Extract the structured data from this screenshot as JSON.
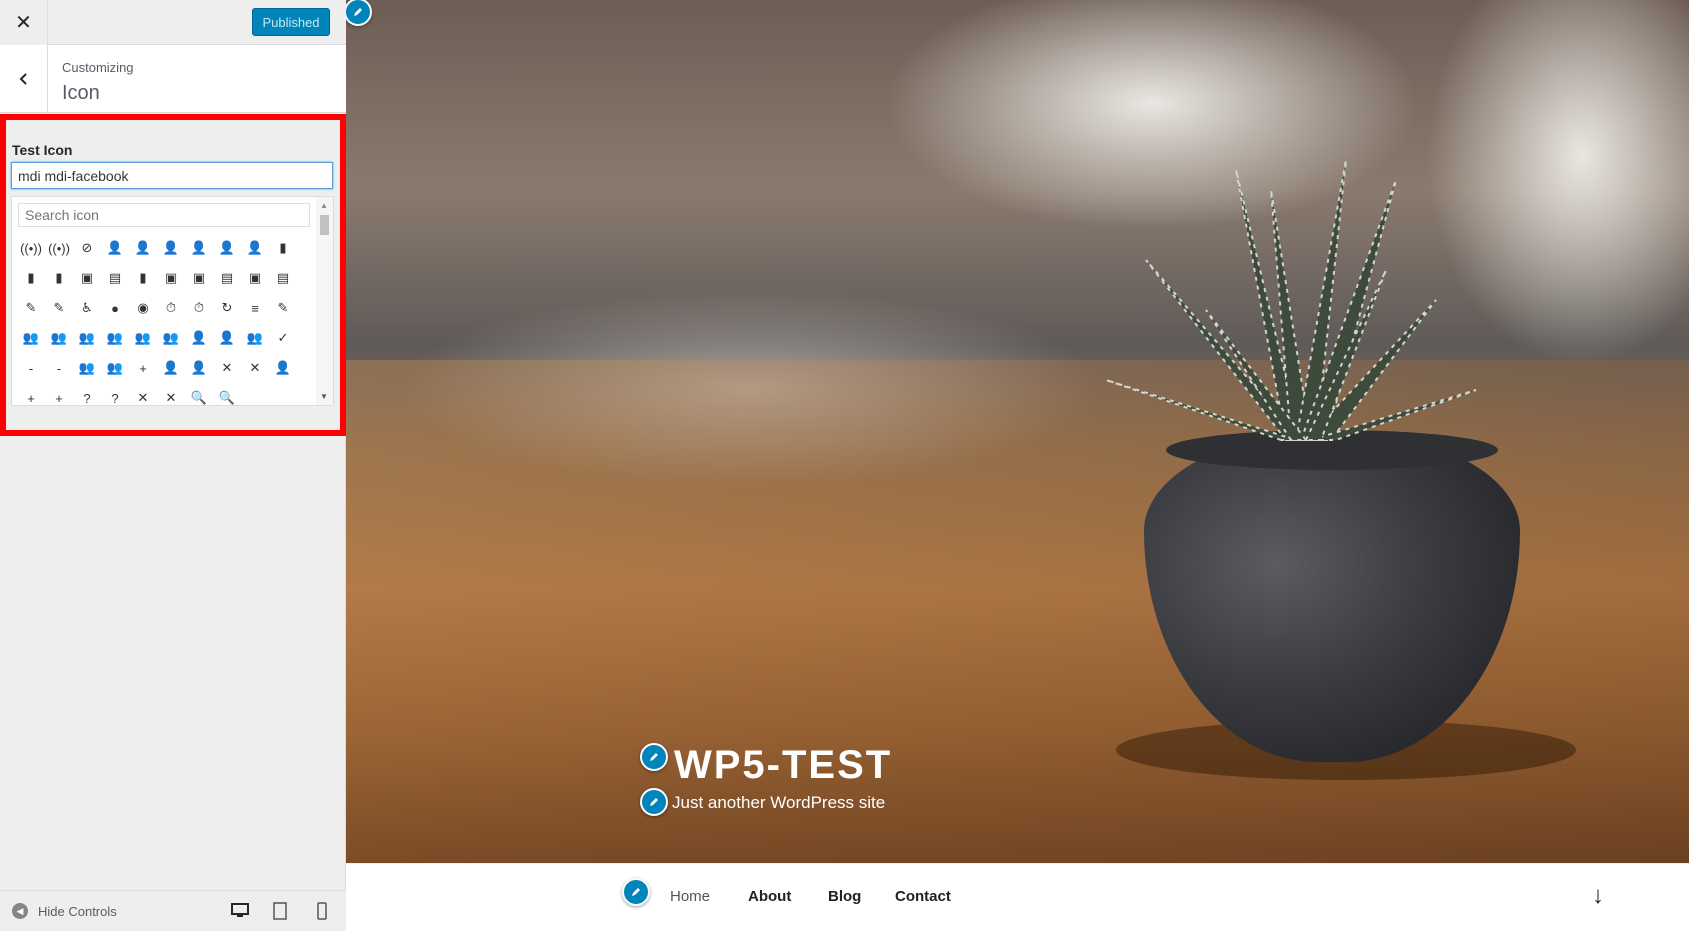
{
  "topbar": {
    "close_label": "✕",
    "publish_label": "Published"
  },
  "section": {
    "breadcrumb": "Customizing",
    "title": "Icon"
  },
  "control": {
    "label": "Test Icon",
    "value": "mdi mdi-facebook",
    "search_placeholder": "Search icon"
  },
  "icon_grid": [
    "((•))",
    "((•))",
    "⊘",
    "👤",
    "👤",
    "👤",
    "👤",
    "👤",
    "👤",
    "▮",
    "▮",
    "▮",
    "▣",
    "▤",
    "▮",
    "▣",
    "▣",
    "▤",
    "▣",
    "▤",
    "✎",
    "✎",
    "♿",
    "●",
    "◉",
    "⏱",
    "⏱",
    "↻",
    "≡",
    "✎",
    "👥",
    "👥",
    "👥",
    "👥",
    "👥",
    "👥",
    "👤",
    "👤",
    "👥",
    "✓",
    "-",
    "-",
    "👥",
    "👥",
    "+",
    "👤",
    "👤",
    "✕",
    "✕",
    "👤",
    "+",
    "+",
    "?",
    "?",
    "✕",
    "✕",
    "🔍",
    "🔍"
  ],
  "footer": {
    "hide_label": "Hide Controls"
  },
  "preview": {
    "site_title": "WP5-TEST",
    "site_description": "Just another WordPress site",
    "nav": [
      "Home",
      "About",
      "Blog",
      "Contact"
    ],
    "scroll_arrow": "↓"
  },
  "colors": {
    "accent": "#0085ba",
    "highlight": "#ff0000"
  }
}
